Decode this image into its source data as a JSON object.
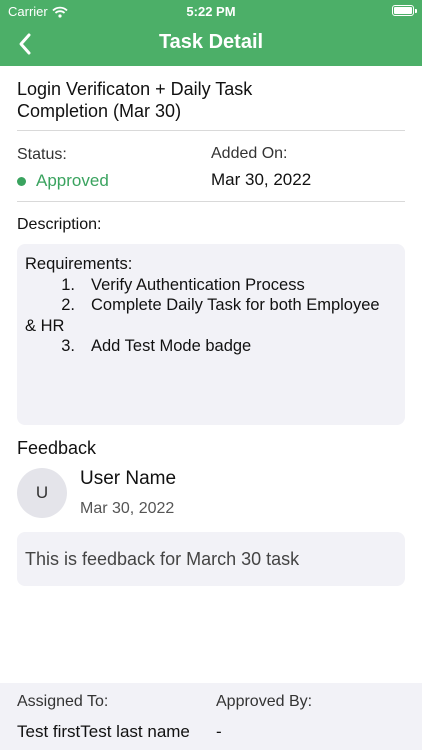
{
  "status_bar": {
    "carrier": "Carrier",
    "time": "5:22 PM"
  },
  "nav": {
    "title": "Task Detail",
    "back_icon": "chevron-left-icon"
  },
  "task": {
    "title": "Login Verificaton + Daily Task Completion (Mar 30)",
    "status_label": "Status:",
    "status_value": "Approved",
    "status_color": "#3aa35f",
    "added_label": "Added On:",
    "added_value": "Mar 30, 2022"
  },
  "description": {
    "label": "Description:",
    "intro": "Requirements:",
    "items": [
      {
        "num": "1.",
        "text": "Verify Authentication Process"
      },
      {
        "num": "2.",
        "text": "Complete Daily Task for both Employee"
      },
      {
        "num": "3.",
        "text": "Add Test Mode badge"
      }
    ],
    "wrap_text": "& HR"
  },
  "feedback": {
    "label": "Feedback",
    "avatar_initial": "U",
    "user_name": "User Name",
    "date": "Mar 30, 2022",
    "message": "This is feedback for March 30 task"
  },
  "footer": {
    "assigned_label": "Assigned To:",
    "assigned_value": "Test firstTest last name",
    "approved_label": "Approved By:",
    "approved_value": "-"
  },
  "colors": {
    "header": "#4caf68",
    "box_background": "#f2f2f7"
  }
}
